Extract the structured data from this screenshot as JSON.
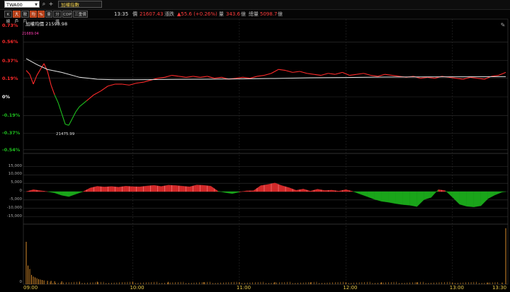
{
  "toolbar": {
    "symbol": "TWA00",
    "index_name": "加權指數",
    "buttons": [
      {
        "label": "K線",
        "active": false
      },
      {
        "label": "大戶",
        "active": true
      },
      {
        "label": "散戶",
        "active": false
      },
      {
        "label": "均",
        "active": true
      },
      {
        "label": "%",
        "active": true
      },
      {
        "label": "量",
        "active": false
      },
      {
        "label": "分價",
        "active": false
      },
      {
        "label": "CDP",
        "active": false
      },
      {
        "label": "三重價",
        "active": false
      }
    ],
    "time": "13:35",
    "price_label": "價",
    "price": "21607.43",
    "change_label": "漲跌",
    "change": "▲55.6 (+0.26%)",
    "volume_label": "量",
    "volume": "343.6",
    "volume_unit": "億",
    "total_label": "總量",
    "total": "5098.7",
    "total_unit": "億"
  },
  "chart_data": {
    "type": "line",
    "title": "加權均價 21598.98",
    "high_annotation": "21689.04",
    "low_annotation": "21475.99",
    "pct_ticks": [
      "0.73%",
      "0.56%",
      "0.37%",
      "0.19%",
      "0%",
      "-0.19%",
      "-0.37%",
      "-0.54%"
    ],
    "x_ticks": [
      "09:00",
      "10:00",
      "11:00",
      "12:00",
      "13:00",
      "13:30"
    ],
    "prev_close": 21551.8,
    "colors": {
      "up": "#ff2a2a",
      "down": "#1fbf1f",
      "avg": "#e6e6e6",
      "volume": "#d98c2b"
    },
    "price_series": [
      [
        0,
        0.27
      ],
      [
        2,
        0.23
      ],
      [
        4,
        0.13
      ],
      [
        6,
        0.22
      ],
      [
        8,
        0.28
      ],
      [
        10,
        0.34
      ],
      [
        12,
        0.26
      ],
      [
        14,
        0.12
      ],
      [
        16,
        0.02
      ],
      [
        18,
        -0.06
      ],
      [
        20,
        -0.17
      ],
      [
        22,
        -0.28
      ],
      [
        24,
        -0.29
      ],
      [
        26,
        -0.22
      ],
      [
        28,
        -0.15
      ],
      [
        30,
        -0.1
      ],
      [
        34,
        -0.04
      ],
      [
        38,
        0.02
      ],
      [
        42,
        0.06
      ],
      [
        46,
        0.11
      ],
      [
        50,
        0.13
      ],
      [
        54,
        0.13
      ],
      [
        58,
        0.12
      ],
      [
        62,
        0.14
      ],
      [
        66,
        0.15
      ],
      [
        70,
        0.17
      ],
      [
        74,
        0.19
      ],
      [
        78,
        0.2
      ],
      [
        82,
        0.22
      ],
      [
        86,
        0.21
      ],
      [
        90,
        0.2
      ],
      [
        94,
        0.21
      ],
      [
        98,
        0.2
      ],
      [
        102,
        0.21
      ],
      [
        106,
        0.19
      ],
      [
        110,
        0.2
      ],
      [
        114,
        0.18
      ],
      [
        118,
        0.19
      ],
      [
        122,
        0.2
      ],
      [
        126,
        0.19
      ],
      [
        130,
        0.21
      ],
      [
        134,
        0.22
      ],
      [
        138,
        0.24
      ],
      [
        142,
        0.28
      ],
      [
        146,
        0.27
      ],
      [
        150,
        0.25
      ],
      [
        154,
        0.26
      ],
      [
        158,
        0.24
      ],
      [
        162,
        0.23
      ],
      [
        166,
        0.22
      ],
      [
        170,
        0.24
      ],
      [
        174,
        0.23
      ],
      [
        178,
        0.25
      ],
      [
        182,
        0.22
      ],
      [
        186,
        0.23
      ],
      [
        190,
        0.24
      ],
      [
        194,
        0.22
      ],
      [
        198,
        0.21
      ],
      [
        202,
        0.23
      ],
      [
        206,
        0.22
      ],
      [
        210,
        0.21
      ],
      [
        214,
        0.2
      ],
      [
        218,
        0.21
      ],
      [
        222,
        0.19
      ],
      [
        226,
        0.2
      ],
      [
        230,
        0.19
      ],
      [
        234,
        0.21
      ],
      [
        238,
        0.2
      ],
      [
        242,
        0.19
      ],
      [
        246,
        0.18
      ],
      [
        250,
        0.2
      ],
      [
        254,
        0.19
      ],
      [
        258,
        0.18
      ],
      [
        262,
        0.21
      ],
      [
        266,
        0.22
      ],
      [
        270,
        0.25
      ]
    ],
    "avg_series": [
      [
        0,
        0.39
      ],
      [
        6,
        0.33
      ],
      [
        12,
        0.28
      ],
      [
        20,
        0.25
      ],
      [
        30,
        0.2
      ],
      [
        40,
        0.18
      ],
      [
        50,
        0.175
      ],
      [
        60,
        0.175
      ],
      [
        80,
        0.178
      ],
      [
        100,
        0.18
      ],
      [
        120,
        0.183
      ],
      [
        140,
        0.188
      ],
      [
        160,
        0.195
      ],
      [
        180,
        0.198
      ],
      [
        200,
        0.202
      ],
      [
        220,
        0.204
      ],
      [
        240,
        0.205
      ],
      [
        260,
        0.206
      ],
      [
        270,
        0.207
      ]
    ],
    "net_ticks": [
      "15,000",
      "10,000",
      "5,000",
      "0",
      "-5,000",
      "-10,000",
      "-15,000"
    ],
    "net_series": [
      [
        0,
        0
      ],
      [
        4,
        1200
      ],
      [
        8,
        600
      ],
      [
        12,
        0
      ],
      [
        16,
        -800
      ],
      [
        20,
        -2200
      ],
      [
        24,
        -3000
      ],
      [
        28,
        -1500
      ],
      [
        32,
        0
      ],
      [
        36,
        2200
      ],
      [
        40,
        3200
      ],
      [
        44,
        2800
      ],
      [
        48,
        3100
      ],
      [
        52,
        2700
      ],
      [
        56,
        3300
      ],
      [
        60,
        3000
      ],
      [
        64,
        2900
      ],
      [
        68,
        3400
      ],
      [
        72,
        3800
      ],
      [
        76,
        3100
      ],
      [
        80,
        3900
      ],
      [
        84,
        3700
      ],
      [
        88,
        3300
      ],
      [
        92,
        2900
      ],
      [
        96,
        4000
      ],
      [
        100,
        3800
      ],
      [
        104,
        3300
      ],
      [
        108,
        300
      ],
      [
        112,
        -600
      ],
      [
        116,
        -1200
      ],
      [
        120,
        -300
      ],
      [
        124,
        500
      ],
      [
        128,
        600
      ],
      [
        132,
        3600
      ],
      [
        136,
        4300
      ],
      [
        140,
        5200
      ],
      [
        144,
        3600
      ],
      [
        148,
        2400
      ],
      [
        152,
        800
      ],
      [
        156,
        1600
      ],
      [
        160,
        300
      ],
      [
        164,
        1500
      ],
      [
        168,
        700
      ],
      [
        172,
        900
      ],
      [
        176,
        300
      ],
      [
        180,
        1200
      ],
      [
        184,
        100
      ],
      [
        188,
        -1500
      ],
      [
        192,
        -3000
      ],
      [
        196,
        -4600
      ],
      [
        200,
        -5800
      ],
      [
        204,
        -6400
      ],
      [
        208,
        -7200
      ],
      [
        212,
        -7800
      ],
      [
        216,
        -8200
      ],
      [
        220,
        -9000
      ],
      [
        224,
        -4800
      ],
      [
        228,
        -3500
      ],
      [
        232,
        1200
      ],
      [
        236,
        600
      ],
      [
        240,
        -3400
      ],
      [
        244,
        -7600
      ],
      [
        248,
        -8800
      ],
      [
        252,
        -9200
      ],
      [
        256,
        -8500
      ],
      [
        260,
        -4200
      ],
      [
        264,
        -2000
      ],
      [
        268,
        -300
      ],
      [
        270,
        0
      ]
    ],
    "net_range": [
      -18000,
      18000
    ],
    "volume_series": [
      [
        0,
        100
      ],
      [
        1,
        44
      ],
      [
        2,
        36
      ],
      [
        3,
        22
      ],
      [
        4,
        18
      ],
      [
        5,
        16
      ],
      [
        6,
        14
      ],
      [
        7,
        12
      ],
      [
        8,
        11
      ],
      [
        9,
        10
      ],
      [
        10,
        9
      ],
      [
        12,
        8
      ],
      [
        14,
        8
      ],
      [
        16,
        7
      ],
      [
        20,
        7
      ],
      [
        30,
        6
      ],
      [
        40,
        6
      ],
      [
        60,
        6
      ],
      [
        80,
        5.5
      ],
      [
        100,
        5
      ],
      [
        120,
        5
      ],
      [
        140,
        5
      ],
      [
        160,
        4.5
      ],
      [
        180,
        4.5
      ],
      [
        200,
        4.5
      ],
      [
        220,
        4.5
      ],
      [
        240,
        4
      ],
      [
        260,
        4
      ],
      [
        268,
        4
      ],
      [
        270,
        132
      ]
    ]
  }
}
